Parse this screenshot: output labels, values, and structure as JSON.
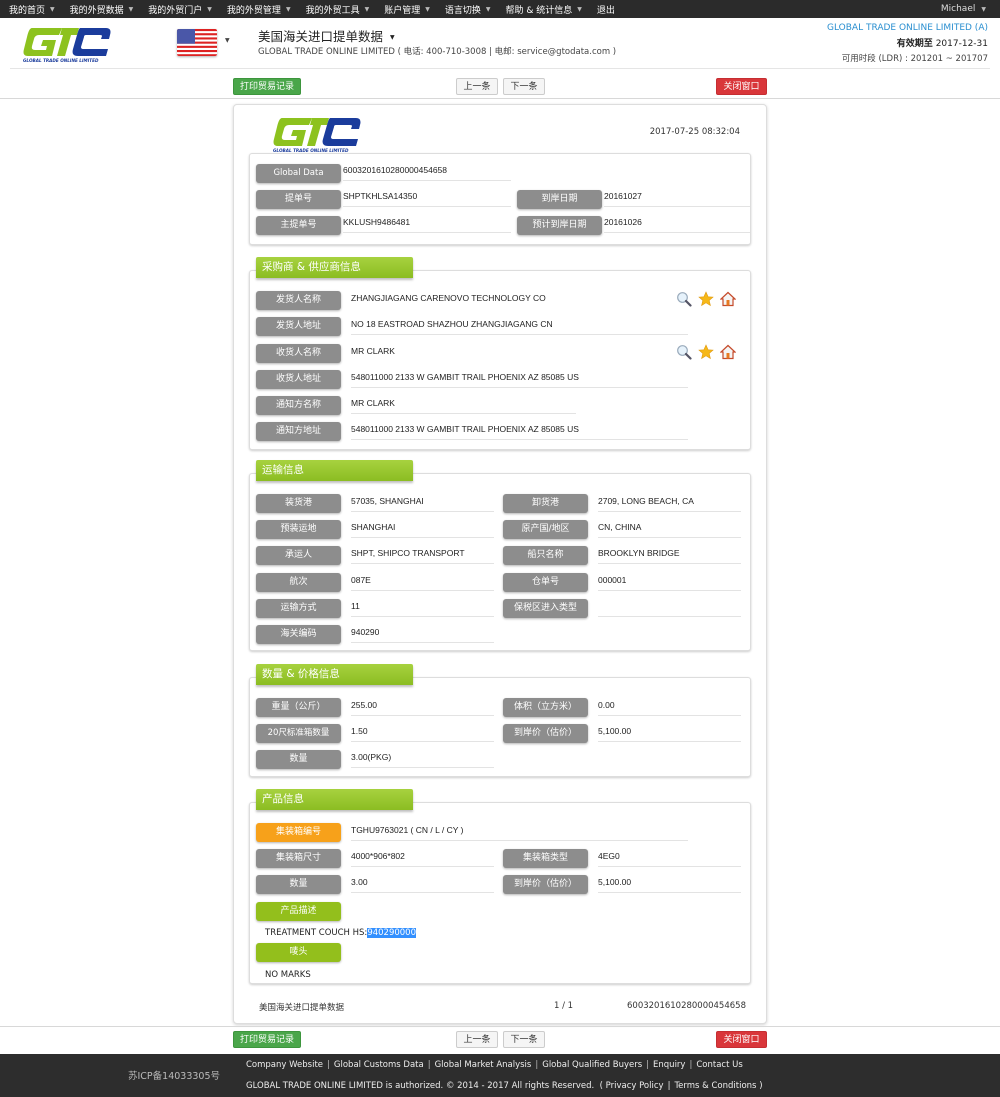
{
  "topnav": {
    "items": [
      {
        "label": "我的首页",
        "caret": true
      },
      {
        "label": "我的外贸数据",
        "caret": true
      },
      {
        "label": "我的外贸门户",
        "caret": true
      },
      {
        "label": "我的外贸管理",
        "caret": true
      },
      {
        "label": "我的外贸工具",
        "caret": true
      },
      {
        "label": "账户管理",
        "caret": true
      },
      {
        "label": "语言切换",
        "caret": true
      },
      {
        "label": "帮助 & 统计信息",
        "caret": true
      },
      {
        "label": "退出",
        "caret": false
      }
    ],
    "user": "Michael",
    "caret_glyph": "▼"
  },
  "header": {
    "logo_text": "GLOBAL TRADE ONLINE LIMITED",
    "country_flag": "us-flag",
    "db_title": "美国海关进口提单数据",
    "db_subtitle": "GLOBAL TRADE ONLINE LIMITED ( 电话:  400-710-3008  | 电邮:  service@gtodata.com )",
    "account_name": "GLOBAL TRADE ONLINE LIMITED (A)",
    "expiry_label": "有效期至",
    "expiry_date": "2017-12-31",
    "range_label": "可用时段 (LDR) : 201201 ~ 201707"
  },
  "actions": {
    "print": "打印贸易记录",
    "prev": "上一条",
    "next": "下一条",
    "close": "关闭窗口"
  },
  "document": {
    "timestamp": "2017-07-25 08:32:04",
    "identity": {
      "gdi_label": "Global Data Identity",
      "gdi_value": "600320161028000045465­8",
      "bill_no_label": "提单号",
      "bill_no_value": "SHPTKHLSA14350",
      "arrival_label": "到岸日期",
      "arrival_value": "20161027",
      "master_bill_label": "主提单号",
      "master_bill_value": "KKLUSH9486481",
      "est_arrival_label": "预计到岸日期",
      "est_arrival_value": "20161026"
    },
    "parties": {
      "title": "采购商 & 供应商信息",
      "rows": [
        {
          "label": "发货人名称",
          "value": "ZHANGJIAGANG CARENOVO TECHNOLOGY CO",
          "icons": true
        },
        {
          "label": "发货人地址",
          "value": "NO 18 EASTROAD SHAZHOU ZHANGJIAGANG CN",
          "icons": false
        },
        {
          "label": "收货人名称",
          "value": "MR CLARK",
          "icons": true
        },
        {
          "label": "收货人地址",
          "value": "548011000 2133 W GAMBIT TRAIL PHOENIX AZ 85085 US",
          "icons": false
        },
        {
          "label": "通知方名称",
          "value": "MR CLARK",
          "icons": false
        },
        {
          "label": "通知方地址",
          "value": "548011000 2133 W GAMBIT TRAIL PHOENIX AZ 85085 US",
          "icons": false
        }
      ]
    },
    "transport": {
      "title": "运输信息",
      "rows": [
        {
          "l_label": "装货港",
          "l_value": "57035, SHANGHAI",
          "r_label": "卸货港",
          "r_value": "2709, LONG BEACH, CA"
        },
        {
          "l_label": "预装运地",
          "l_value": "SHANGHAI",
          "r_label": "原产国/地区",
          "r_value": "CN, CHINA"
        },
        {
          "l_label": "承运人",
          "l_value": "SHPT, SHIPCO TRANSPORT",
          "r_label": "船只名称",
          "r_value": "BROOKLYN BRIDGE"
        },
        {
          "l_label": "航次",
          "l_value": "087E",
          "r_label": "仓单号",
          "r_value": "000001"
        },
        {
          "l_label": "运输方式",
          "l_value": "11",
          "r_label": "保税区进入类型",
          "r_value": ""
        },
        {
          "l_label": "海关编码",
          "l_value": "940290"
        }
      ]
    },
    "quantity": {
      "title": "数量 & 价格信息",
      "rows": [
        {
          "l_label": "重量（公斤）",
          "l_value": "255.00",
          "r_label": "体积（立方米）",
          "r_value": "0.00"
        },
        {
          "l_label": "20尺标准箱数量",
          "l_value": "1.50",
          "r_label": "到岸价（估价）",
          "r_value": "5,100.00"
        },
        {
          "l_label": "数量",
          "l_value": "3.00(PKG)"
        }
      ]
    },
    "product": {
      "title": "产品信息",
      "container_label": "集装箱编号",
      "container_value": "TGHU9763021 ( CN / L / CY )",
      "size_label": "集装箱尺寸",
      "size_value": "4000*906*802",
      "type_label": "集装箱类型",
      "type_value": "4EG0",
      "qty_label": "数量",
      "qty_value": "3.00",
      "price_label": "到岸价（估价）",
      "price_value": "5,100.00",
      "desc_label": "产品描述",
      "desc_prefix": "TREATMENT COUCH HS:",
      "desc_selected": "940290000",
      "marks_label": "唛头",
      "marks_value": "NO MARKS"
    },
    "footer": {
      "db_name": "美国海关进口提单数据",
      "page": "1 / 1",
      "id": "6003201610280000454658"
    }
  },
  "footer": {
    "icp": "苏ICP备14033305号",
    "links": [
      "Company Website",
      "Global Customs Data",
      "Global Market Analysis",
      "Global Qualified Buyers",
      "Enquiry",
      "Contact Us"
    ],
    "copyright": "GLOBAL TRADE ONLINE LIMITED is authorized. © 2014 - 2017 All rights Reserved.  ( ",
    "privacy": "Privacy Policy",
    "terms": "Terms & Conditions",
    "close_paren": " )"
  }
}
